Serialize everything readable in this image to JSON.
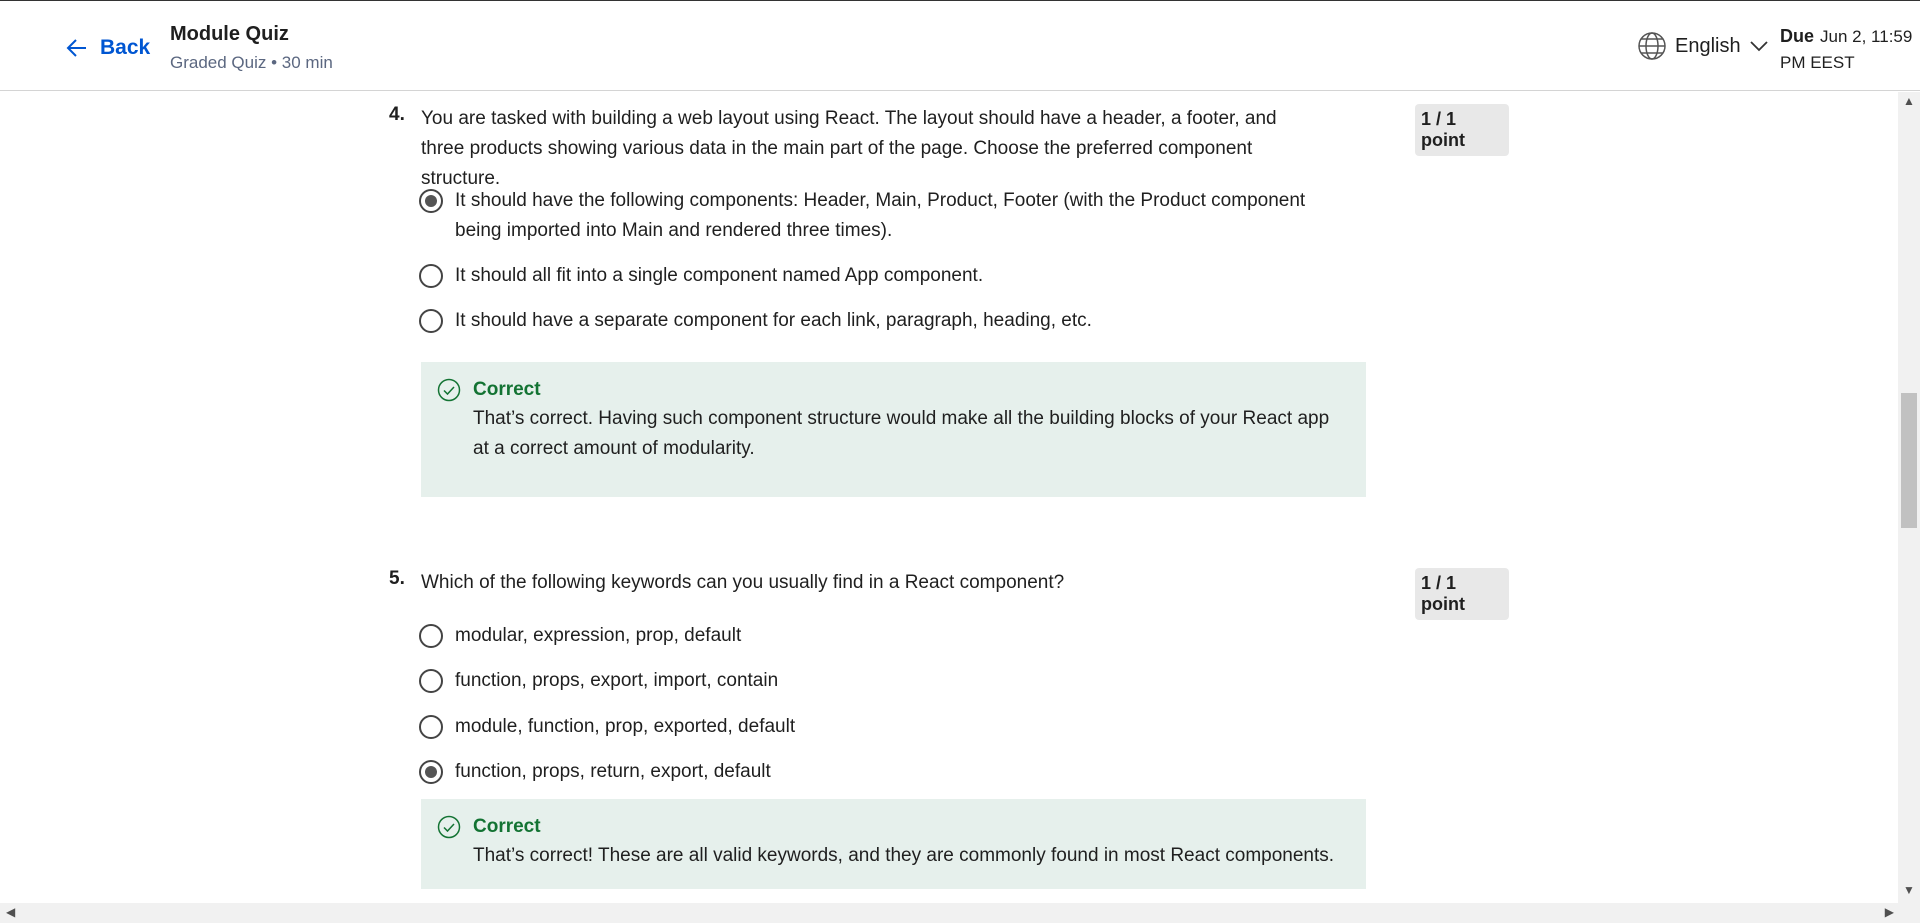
{
  "header": {
    "back_label": "Back",
    "title": "Module Quiz",
    "subtitle": "Graded Quiz • 30 min",
    "language": "English",
    "due_label": "Due",
    "due_date": "Jun 2, 11:59 PM EEST"
  },
  "questions": [
    {
      "number": "4.",
      "text": "You are tasked with building a web layout using React. The layout should have a header, a footer, and three products showing various data in the main part of the page. Choose the preferred component structure.",
      "points": "1 / 1 point",
      "options": [
        {
          "label": "It should have the following components: Header, Main, Product, Footer (with the Product component being imported into Main and rendered three times).",
          "selected": true
        },
        {
          "label": "It should all fit into a single component named App component.",
          "selected": false
        },
        {
          "label": "It should have a separate component for each link, paragraph, heading, etc.",
          "selected": false
        }
      ],
      "feedback": {
        "title": "Correct",
        "text": "That’s correct. Having such component structure would make all the building blocks of your React app at a correct amount of modularity."
      }
    },
    {
      "number": "5.",
      "text": "Which of the following keywords can you usually find in a React component?",
      "points": "1 / 1 point",
      "options": [
        {
          "label": "modular, expression, prop, default",
          "selected": false
        },
        {
          "label": "function, props, export, import, contain",
          "selected": false
        },
        {
          "label": "module, function, prop, exported, default",
          "selected": false
        },
        {
          "label": "function, props, return, export, default",
          "selected": true
        }
      ],
      "feedback": {
        "title": "Correct",
        "text": "That’s correct! These are all valid keywords, and they are commonly found in most React components."
      }
    }
  ],
  "colors": {
    "link": "#0056d2",
    "correct": "#137333",
    "feedback_bg": "#e6f0ec"
  },
  "icons": {
    "back": "arrow-left-icon",
    "language": "globe-icon",
    "language_caret": "chevron-down-icon",
    "feedback": "check-circle-icon"
  }
}
